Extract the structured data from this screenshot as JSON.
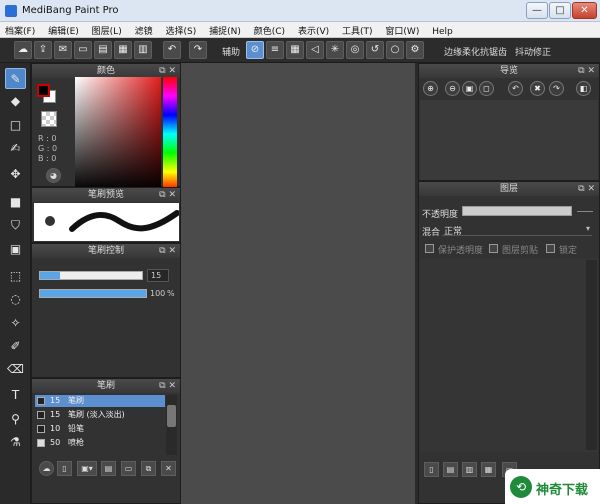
{
  "window": {
    "title": "MediBang Paint Pro",
    "min_icon": "minimize-icon",
    "max_icon": "maximize-icon",
    "close_icon": "close-icon",
    "min_glyph": "—",
    "max_glyph": "□",
    "close_glyph": "✕"
  },
  "menu": [
    "档案(F)",
    "编辑(E)",
    "图层(L)",
    "滤镜",
    "选择(S)",
    "捕捉(N)",
    "颜色(C)",
    "表示(V)",
    "工具(T)",
    "窗口(W)",
    "Help"
  ],
  "toolbar": {
    "assist_label": "辅助",
    "antialias_label": "边缘柔化抗锯齿",
    "stabilizer_label": "抖动修正"
  },
  "panels": {
    "color": {
      "title": "颜色",
      "r": "R : 0",
      "g": "G : 0",
      "b": "B : 0",
      "fg_color": "#000000",
      "bg_color": "#ffffff"
    },
    "brush_preview": {
      "title": "笔刷预览"
    },
    "brush_control": {
      "title": "笔刷控制",
      "size_value": "15",
      "opacity_value": "100",
      "opacity_unit": "%",
      "size_fraction": 0.2,
      "opacity_fraction": 1.0
    },
    "brush": {
      "title": "笔刷",
      "items": [
        {
          "size": "15",
          "name": "笔刷",
          "selected": true
        },
        {
          "size": "15",
          "name": "笔刷 (淡入淡出)",
          "selected": false
        },
        {
          "size": "10",
          "name": "铅笔",
          "selected": false
        },
        {
          "size": "50",
          "name": "喷枪",
          "selected": false
        }
      ]
    },
    "navigator": {
      "title": "导览"
    },
    "layer": {
      "title": "图层",
      "opacity_label": "不透明度",
      "blend_label": "混合",
      "blend_value": "正常",
      "protect_alpha_label": "保护透明度",
      "clipping_label": "图层剪贴",
      "lock_label": "锁定"
    }
  },
  "watermark": {
    "text": "神奇下载",
    "logo_glyph": "⟲"
  },
  "colors": {
    "accent": "#5b8fd0",
    "panel": "#323232",
    "canvas": "#4b4b4b"
  }
}
